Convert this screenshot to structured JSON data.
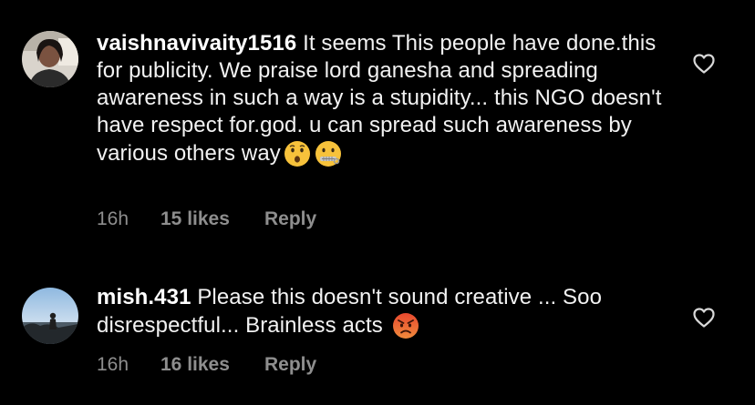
{
  "comments": [
    {
      "username": "vaishnavivaity1516",
      "text": "It seems This people have done.this for publicity. We praise lord ganesha and spreading awareness in such a way is a stupidity... this NGO doesn't have respect for.god. u can spread such awareness by various others way",
      "emojis": [
        "hushed-face-emoji",
        "zipper-mouth-face-emoji"
      ],
      "time": "16h",
      "likes": "15 likes",
      "reply_label": "Reply"
    },
    {
      "username": "mish.431",
      "text": "Please this doesn't sound creative ... Soo disrespectful... Brainless acts",
      "emojis": [
        "angry-face-emoji"
      ],
      "time": "16h",
      "likes": "16 likes",
      "reply_label": "Reply"
    }
  ],
  "icons": {
    "like": "heart-outline-icon"
  },
  "colors": {
    "background": "#000000",
    "text": "#f2f2f2",
    "meta": "#8e8e8e",
    "emoji_yellow": "#f7c23b",
    "emoji_red": "#e8492f"
  }
}
